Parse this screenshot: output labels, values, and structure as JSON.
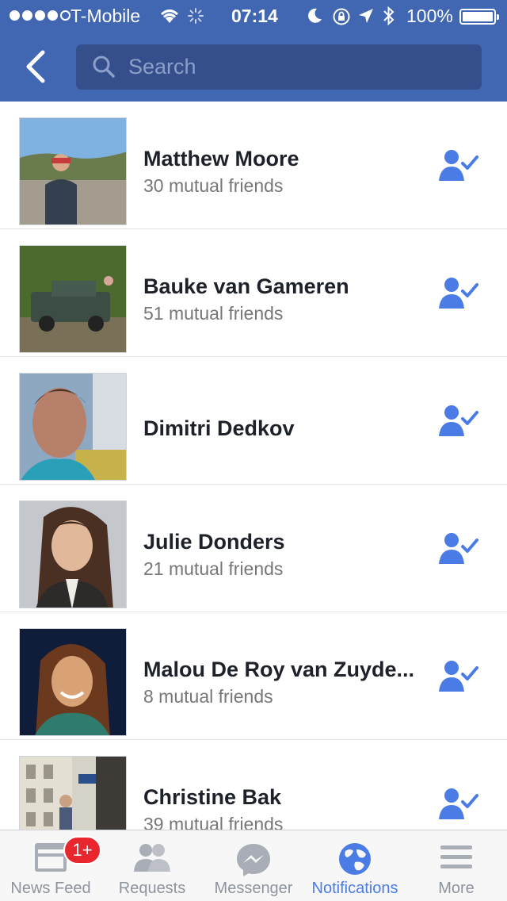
{
  "status_bar": {
    "carrier": "T-Mobile",
    "time": "07:14",
    "battery": "100%",
    "signal_bars": 4
  },
  "nav": {
    "search_placeholder": "Search"
  },
  "friends": [
    {
      "name": "Matthew Moore",
      "mutual": "30 mutual friends"
    },
    {
      "name": "Bauke van Gameren",
      "mutual": "51 mutual friends"
    },
    {
      "name": "Dimitri Dedkov",
      "mutual": ""
    },
    {
      "name": "Julie Donders",
      "mutual": "21 mutual friends"
    },
    {
      "name": "Malou De Roy van Zuyde...",
      "mutual": "8 mutual friends"
    },
    {
      "name": "Christine Bak",
      "mutual": "39 mutual friends"
    }
  ],
  "tabs": [
    {
      "label": "News Feed",
      "icon": "news-feed-icon",
      "badge": "1+"
    },
    {
      "label": "Requests",
      "icon": "friend-requests-icon"
    },
    {
      "label": "Messenger",
      "icon": "messenger-icon"
    },
    {
      "label": "Notifications",
      "icon": "globe-icon",
      "active": true
    },
    {
      "label": "More",
      "icon": "hamburger-menu-icon"
    }
  ],
  "colors": {
    "brand_blue": "#4267b2",
    "search_bg": "#354f8c",
    "accent": "#4b7ce5",
    "badge_red": "#e8262d"
  }
}
